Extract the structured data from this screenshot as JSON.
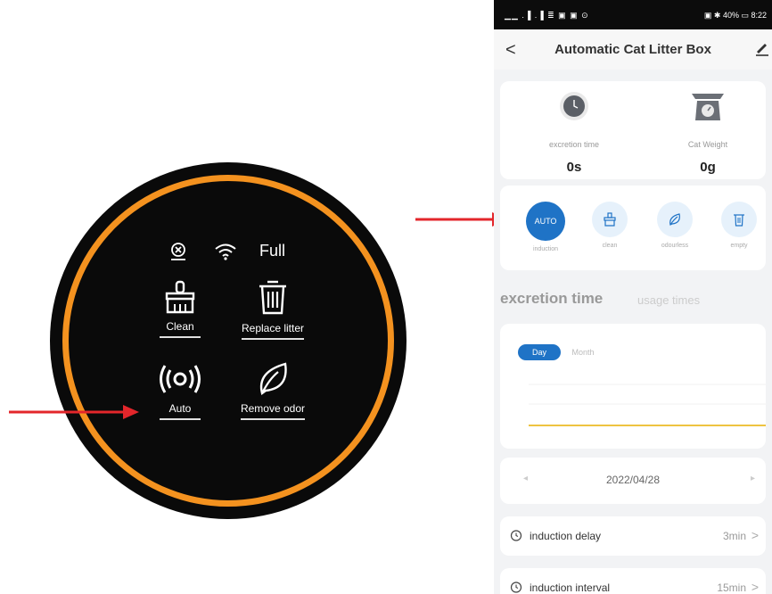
{
  "device_panel": {
    "status_text": "Full",
    "buttons": [
      {
        "label": "Clean",
        "icon": "brush-icon"
      },
      {
        "label": "Replace litter",
        "icon": "trash-icon"
      },
      {
        "label": "Auto",
        "icon": "radar-icon"
      },
      {
        "label": "Remove odor",
        "icon": "leaf-icon"
      }
    ],
    "ring_color": "#f4921f"
  },
  "phone": {
    "status_bar": {
      "left": "▁▁ .▐ .▐ ≣ ▣ ▣ ⊙",
      "right": "▣ ✱ 40% ▭ 8:22"
    },
    "app_bar": {
      "title": "Automatic Cat Litter Box",
      "back": "<"
    },
    "stats": [
      {
        "label": "excretion time",
        "value": "0s",
        "icon": "clock-icon"
      },
      {
        "label": "Cat Weight",
        "value": "0g",
        "icon": "scale-icon"
      }
    ],
    "modes": [
      {
        "label": "induction",
        "badge": "AUTO"
      },
      {
        "label": "clean",
        "icon": "brush-icon"
      },
      {
        "label": "odourless",
        "icon": "leaf-icon"
      },
      {
        "label": "empty",
        "icon": "trash-icon"
      }
    ],
    "tabs": [
      "excretion time",
      "usage times"
    ],
    "chart_toggle": {
      "day": "Day",
      "month": "Month"
    },
    "date_nav": {
      "prev": "◂",
      "date": "2022/04/28",
      "next": "▸"
    },
    "settings": [
      {
        "label": "induction delay",
        "value": "3min"
      },
      {
        "label": "induction interval",
        "value": "15min"
      }
    ],
    "accent_color": "#1f73c6"
  }
}
